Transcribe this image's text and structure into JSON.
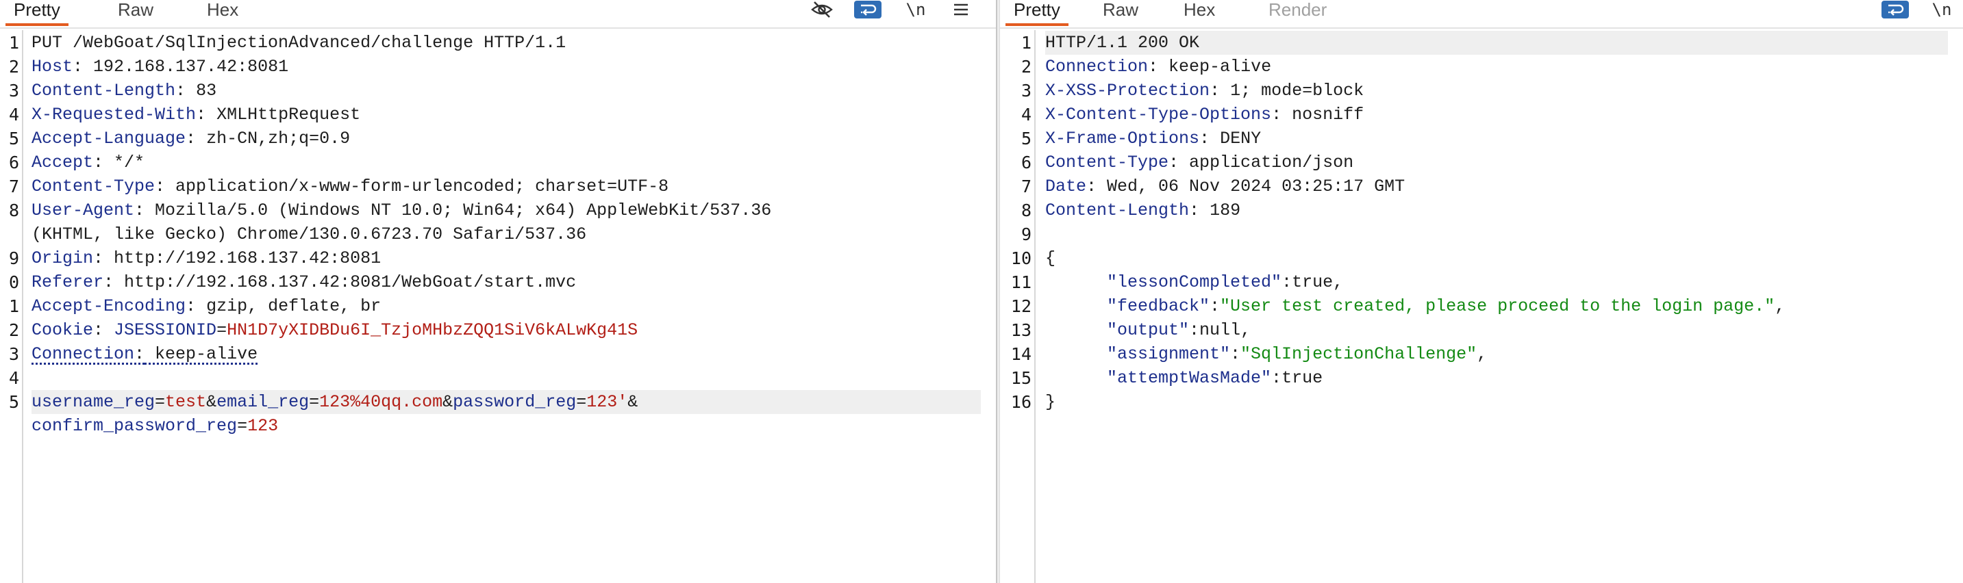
{
  "request": {
    "tabs": [
      "Pretty",
      "Raw",
      "Hex"
    ],
    "line_numbers": [
      "1",
      "2",
      "3",
      "4",
      "5",
      "6",
      "7",
      "8",
      "",
      "9",
      "0",
      "1",
      "2",
      "3",
      "4",
      "5",
      ""
    ],
    "request_line": "PUT /WebGoat/SqlInjectionAdvanced/challenge HTTP/1.1",
    "headers": [
      {
        "name": "Host",
        "value": " 192.168.137.42:8081"
      },
      {
        "name": "Content-Length",
        "value": " 83"
      },
      {
        "name": "X-Requested-With",
        "value": " XMLHttpRequest"
      },
      {
        "name": "Accept-Language",
        "value": " zh-CN,zh;q=0.9"
      },
      {
        "name": "Accept",
        "value": " */*"
      },
      {
        "name": "Content-Type",
        "value": " application/x-www-form-urlencoded; charset=UTF-8"
      },
      {
        "name": "User-Agent",
        "value": " Mozilla/5.0 (Windows NT 10.0; Win64; x64) AppleWebKit/537.36"
      },
      {
        "name": "",
        "value": "(KHTML, like Gecko) Chrome/130.0.6723.70 Safari/537.36"
      },
      {
        "name": "Origin",
        "value": " http://192.168.137.42:8081"
      },
      {
        "name": "Referer",
        "value": " http://192.168.137.42:8081/WebGoat/start.mvc"
      },
      {
        "name": "Accept-Encoding",
        "value": " gzip, deflate, br"
      }
    ],
    "cookie": {
      "name": "Cookie",
      "sep": ": ",
      "key": "JSESSIONID",
      "eq": "=",
      "val": "HN1D7yXIDBDu6I_TzjoMHbzZQQ1SiV6kALwKg41S"
    },
    "connection": {
      "name": "Connection",
      "value": " keep-alive"
    },
    "body": {
      "p1k": "username_reg",
      "p1v": "test",
      "p2k": "email_reg",
      "p2v": "123%40qq.com",
      "p3k": "password_reg",
      "p3v": "123'",
      "amp": "&",
      "eq": "=",
      "p4k": "confirm_password_reg",
      "p4v": "123"
    }
  },
  "response": {
    "tabs": [
      "Pretty",
      "Raw",
      "Hex",
      "Render"
    ],
    "line_numbers": [
      "1",
      "2",
      "3",
      "4",
      "5",
      "6",
      "7",
      "8",
      "9",
      "10",
      "11",
      "12",
      "13",
      "14",
      "15",
      "16"
    ],
    "status_line": "HTTP/1.1 200 OK",
    "headers": [
      {
        "name": "Connection",
        "value": " keep-alive"
      },
      {
        "name": "X-XSS-Protection",
        "value": " 1; mode=block"
      },
      {
        "name": "X-Content-Type-Options",
        "value": " nosniff"
      },
      {
        "name": "X-Frame-Options",
        "value": " DENY"
      },
      {
        "name": "Content-Type",
        "value": " application/json"
      },
      {
        "name": "Date",
        "value": " Wed, 06 Nov 2024 03:25:17 GMT"
      },
      {
        "name": "Content-Length",
        "value": " 189"
      }
    ],
    "json_open": "{",
    "json_close": "}",
    "json": [
      {
        "key": "\"lessonCompleted\"",
        "sep": ":",
        "val": "true",
        "str": false,
        "end": ","
      },
      {
        "key": "\"feedback\"",
        "sep": ":",
        "val": "\"User test created, please proceed to the login page.\"",
        "str": true,
        "end": ","
      },
      {
        "key": "\"output\"",
        "sep": ":",
        "val": "null",
        "str": false,
        "end": ","
      },
      {
        "key": "\"assignment\"",
        "sep": ":",
        "val": "\"SqlInjectionChallenge\"",
        "str": true,
        "end": ","
      },
      {
        "key": "\"attemptWasMade\"",
        "sep": ":",
        "val": "true",
        "str": false,
        "end": ""
      }
    ]
  },
  "toolbar": {
    "newline_label": "\\n"
  },
  "colors": {
    "accent": "#e35b20",
    "wrap_button": "#2f6db5",
    "header_name": "#1d2f8c",
    "cookie_value": "#b21e16",
    "json_string": "#138a13"
  }
}
